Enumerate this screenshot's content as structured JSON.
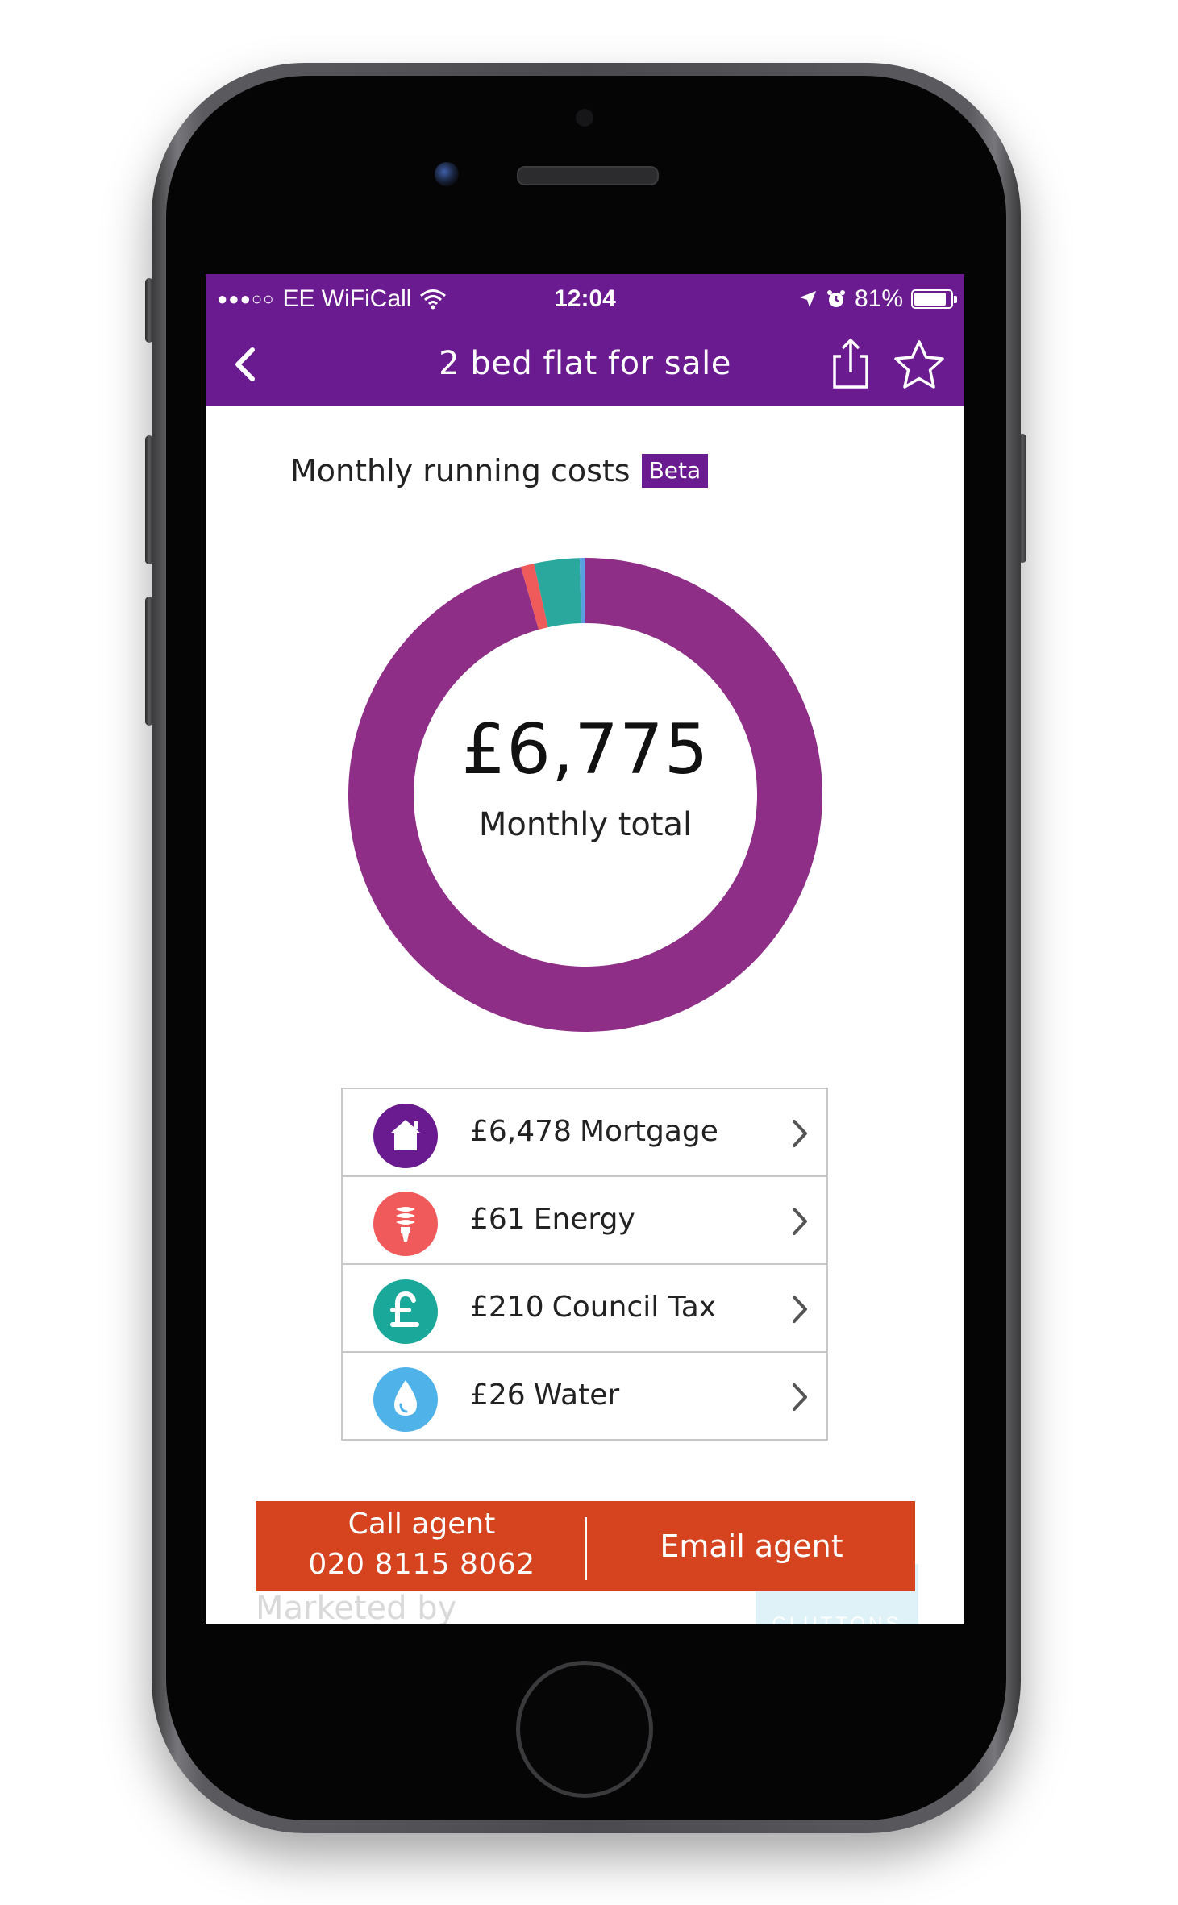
{
  "status_bar": {
    "signal": "●●●○○",
    "carrier": "EE WiFiCall",
    "time": "12:04",
    "battery_percent": "81%",
    "battery_level": 0.81
  },
  "nav": {
    "title": "2 bed flat for sale"
  },
  "section": {
    "title": "Monthly running costs",
    "badge": "Beta"
  },
  "chart_data": {
    "type": "pie",
    "categories": [
      "Mortgage",
      "Energy",
      "Council Tax",
      "Water"
    ],
    "values": [
      6478,
      61,
      210,
      26
    ],
    "colors": [
      "#8e2e86",
      "#ef5a5a",
      "#2aa89e",
      "#5aa0e0"
    ],
    "center_value": "£6,775",
    "center_label": "Monthly total"
  },
  "costs": {
    "items": [
      {
        "amount": "£6,478",
        "label": "Mortgage",
        "icon": "house-icon",
        "color": "#6a1b8f"
      },
      {
        "amount": "£61",
        "label": "Energy",
        "icon": "lightbulb-icon",
        "color": "#f05a5a"
      },
      {
        "amount": "£210",
        "label": "Council Tax",
        "icon": "pound-icon",
        "color": "#1aa89a"
      },
      {
        "amount": "£26",
        "label": "Water",
        "icon": "water-drop-icon",
        "color": "#4fb3ea"
      }
    ]
  },
  "cta": {
    "call_label": "Call agent",
    "call_number": "020 8115 8062",
    "email_label": "Email agent",
    "color": "#d5431f"
  },
  "footer": {
    "marketed_by": "Marketed by",
    "agent_name": "CLUTTONS"
  }
}
